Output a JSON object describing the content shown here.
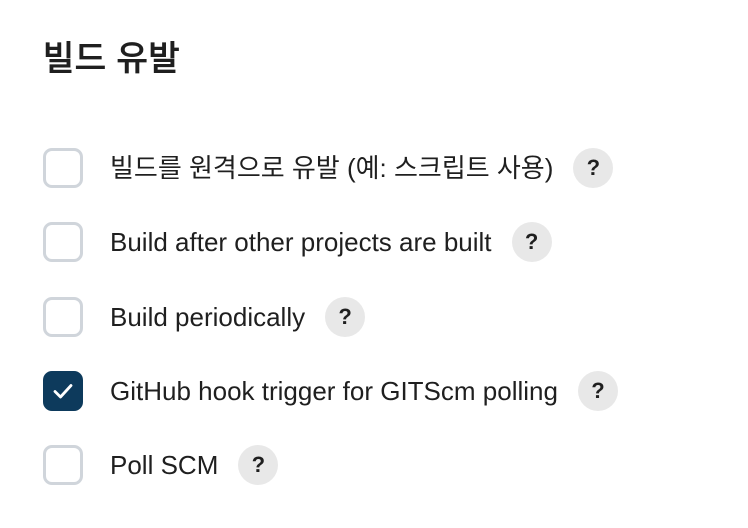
{
  "section": {
    "title": "빌드 유발"
  },
  "options": [
    {
      "label": "빌드를 원격으로 유발 (예: 스크립트 사용)",
      "checked": false,
      "help": "?"
    },
    {
      "label": "Build after other projects are built",
      "checked": false,
      "help": "?"
    },
    {
      "label": "Build periodically",
      "checked": false,
      "help": "?"
    },
    {
      "label": "GitHub hook trigger for GITScm polling",
      "checked": true,
      "help": "?"
    },
    {
      "label": "Poll SCM",
      "checked": false,
      "help": "?"
    }
  ],
  "colors": {
    "checked_fill": "#0d3a5c",
    "unchecked_border": "#d0d5db",
    "help_background": "#e8e8e8",
    "text": "#1f1f1f"
  },
  "icons": {
    "checkbox_checked": "check-icon",
    "help": "question-mark-icon"
  }
}
